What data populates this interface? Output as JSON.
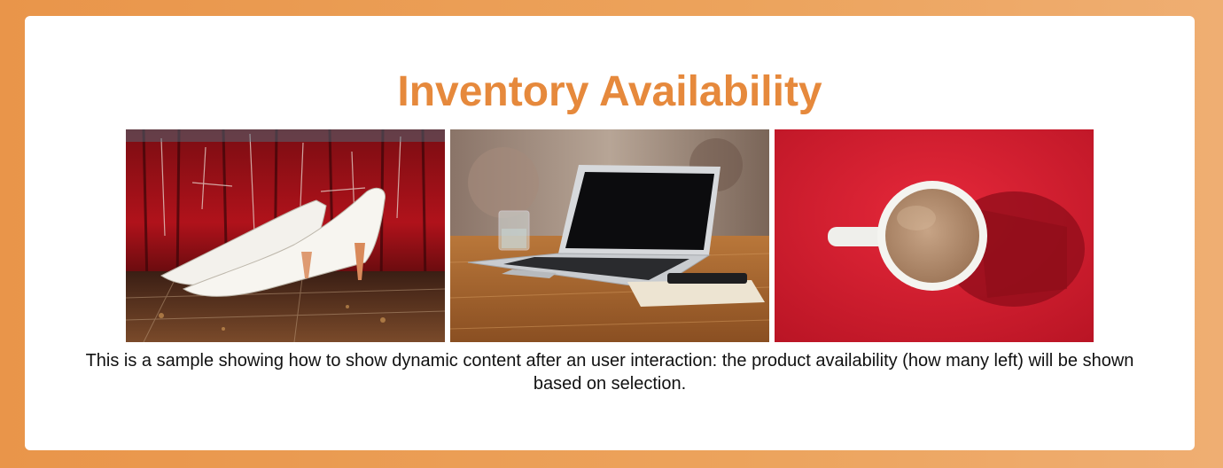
{
  "page": {
    "title": "Inventory Availability",
    "description": "This is a sample showing how to show dynamic content after an user interaction: the product availability (how many left) will be shown based on selection."
  },
  "products": [
    {
      "name": "white-heels",
      "subject": "White high-heel shoes on a paint-splattered wooden floor"
    },
    {
      "name": "laptop",
      "subject": "Laptop on a wooden table with a glass and notebook"
    },
    {
      "name": "coffee-mug",
      "subject": "Cup of coffee with milk on a red background"
    }
  ],
  "colors": {
    "background_gradient_start": "#e9954a",
    "background_gradient_end": "#efae72",
    "card": "#ffffff",
    "title": "#e6893c",
    "text": "#111111"
  }
}
